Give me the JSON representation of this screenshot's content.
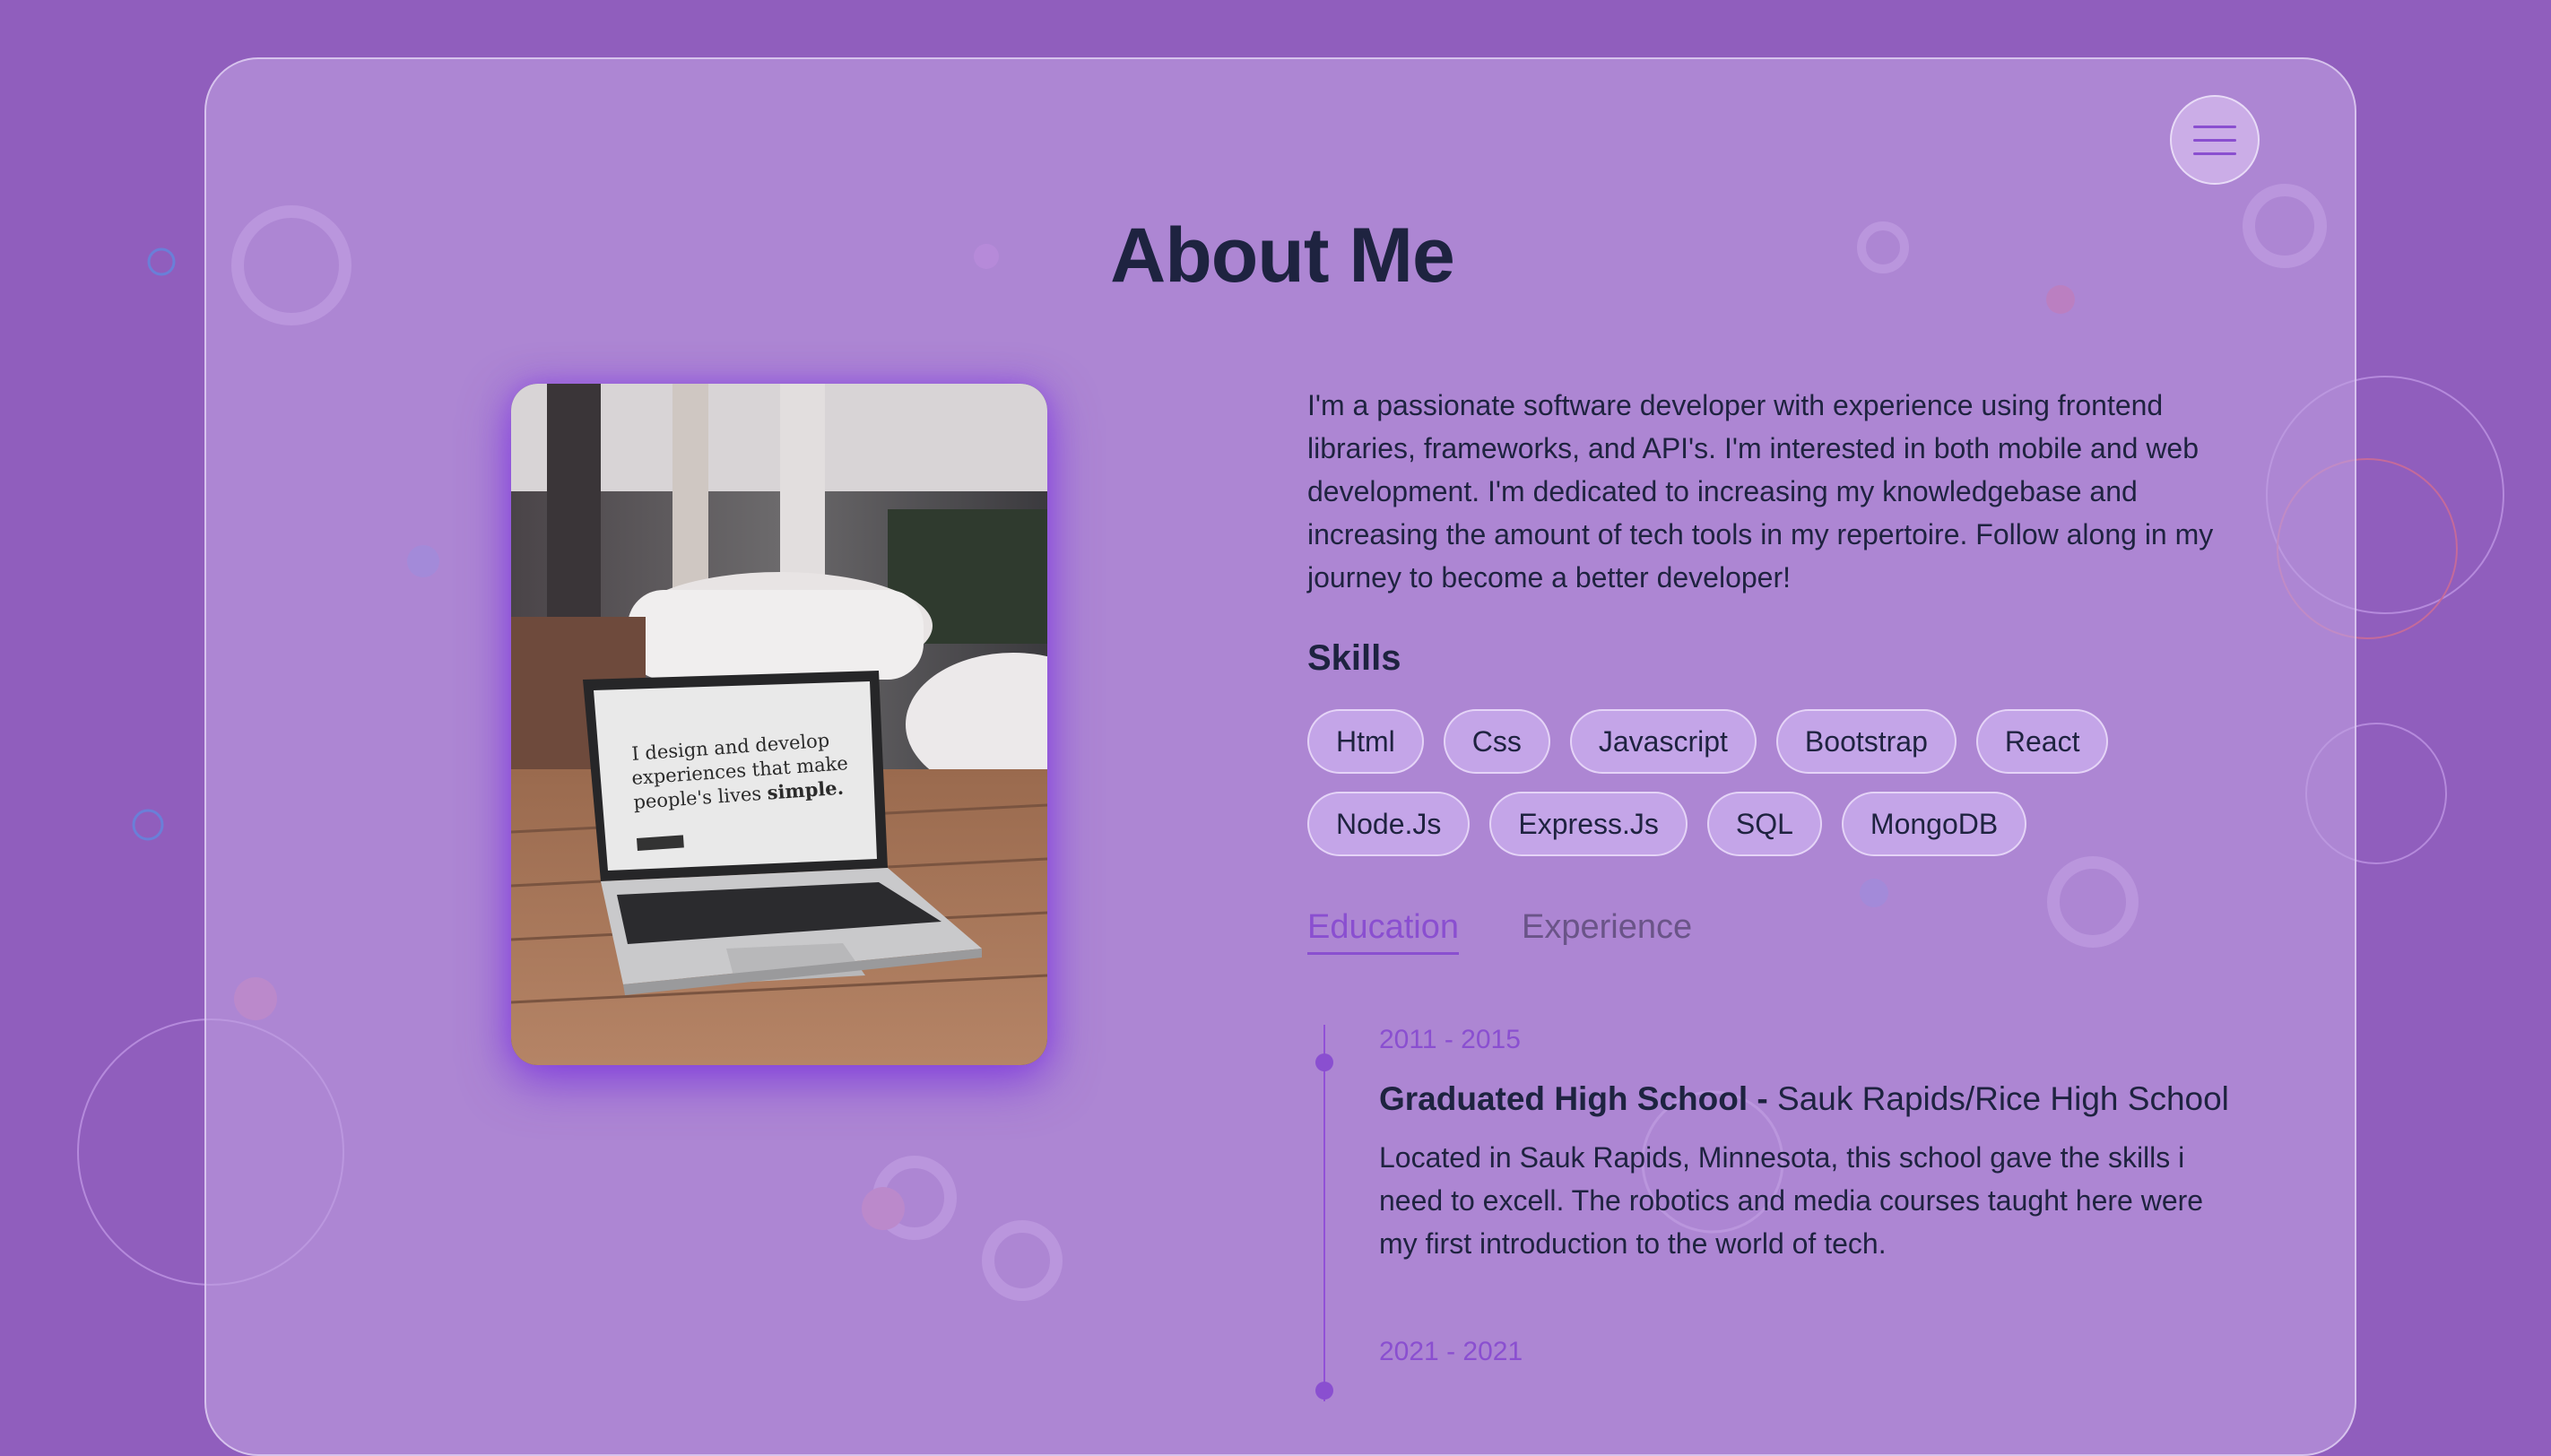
{
  "colors": {
    "page_background": "#905ebd",
    "accent": "#8a4fd0",
    "text_dark": "#1e2340"
  },
  "header": {
    "menu_icon": "hamburger-menu-icon",
    "title": "About Me"
  },
  "photo": {
    "screen_text_line1": "I design and develop",
    "screen_text_line2": "experiences that make",
    "screen_text_line3": "people's lives",
    "screen_text_bold": "simple."
  },
  "about": {
    "bio": "I'm a passionate software developer with experience using frontend libraries, frameworks, and API's. I'm interested in both mobile and web development. I'm dedicated to increasing my knowledgebase and increasing the amount of tech tools in my repertoire. Follow along in my journey to become a better developer!",
    "skills_title": "Skills",
    "skills": [
      "Html",
      "Css",
      "Javascript",
      "Bootstrap",
      "React",
      "Node.Js",
      "Express.Js",
      "SQL",
      "MongoDB"
    ]
  },
  "tabs": [
    {
      "label": "Education",
      "active": true
    },
    {
      "label": "Experience",
      "active": false
    }
  ],
  "timeline": [
    {
      "date": "2011 - 2015",
      "title_bold": "Graduated High School -",
      "title_rest": " Sauk Rapids/Rice High School",
      "description": "Located in Sauk Rapids, Minnesota, this school gave the skills i need to excell. The robotics and media courses taught here were my first introduction to the world of tech."
    },
    {
      "date": "2021 - 2021"
    }
  ]
}
